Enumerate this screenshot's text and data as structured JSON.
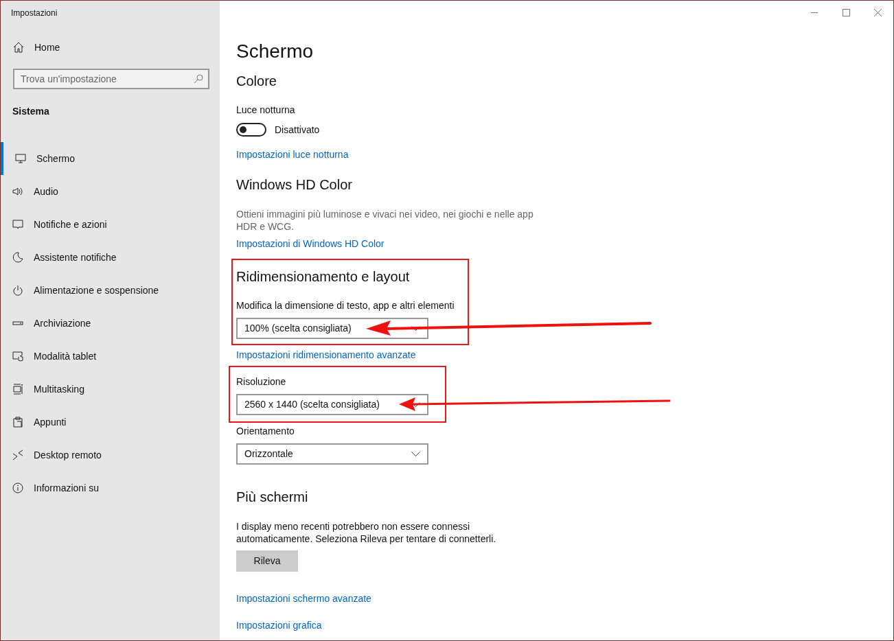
{
  "window": {
    "title": "Impostazioni"
  },
  "sidebar": {
    "home": "Home",
    "search": {
      "placeholder": "Trova un'impostazione"
    },
    "section": "Sistema",
    "items": [
      {
        "label": "Schermo",
        "selected": true
      },
      {
        "label": "Audio",
        "selected": false
      },
      {
        "label": "Notifiche e azioni",
        "selected": false
      },
      {
        "label": "Assistente notifiche",
        "selected": false
      },
      {
        "label": "Alimentazione e sospensione",
        "selected": false
      },
      {
        "label": "Archiviazione",
        "selected": false
      },
      {
        "label": "Modalità tablet",
        "selected": false
      },
      {
        "label": "Multitasking",
        "selected": false
      },
      {
        "label": "Appunti",
        "selected": false
      },
      {
        "label": "Desktop remoto",
        "selected": false
      },
      {
        "label": "Informazioni su",
        "selected": false
      }
    ]
  },
  "content": [
    {
      "kind": "page_title",
      "text": "Schermo"
    },
    {
      "kind": "heading",
      "text": "Colore"
    },
    {
      "kind": "label",
      "text": "Luce notturna"
    },
    {
      "kind": "toggle",
      "on": false,
      "text": "Disattivato"
    },
    {
      "kind": "link",
      "text": "Impostazioni luce notturna"
    },
    {
      "kind": "heading",
      "text": "Windows HD Color"
    },
    {
      "kind": "paragraph",
      "text": "Ottieni immagini più luminose e vivaci nei video, nei giochi e nelle app HDR e WCG.",
      "muted": true
    },
    {
      "kind": "link",
      "text": "Impostazioni di Windows HD Color"
    },
    {
      "kind": "heading",
      "text": "Ridimensionamento e layout"
    },
    {
      "kind": "label",
      "text": "Modifica la dimensione di testo, app e altri elementi"
    },
    {
      "kind": "dropdown",
      "value": "100% (scelta consigliata)"
    },
    {
      "kind": "link",
      "text": "Impostazioni ridimensionamento avanzate"
    },
    {
      "kind": "label",
      "text": "Risoluzione"
    },
    {
      "kind": "dropdown",
      "value": "2560 x 1440 (scelta consigliata)"
    },
    {
      "kind": "label",
      "text": "Orientamento"
    },
    {
      "kind": "dropdown",
      "value": "Orizzontale"
    },
    {
      "kind": "heading",
      "text": "Più schermi"
    },
    {
      "kind": "paragraph",
      "text": "I display meno recenti potrebbero non essere connessi automaticamente. Seleziona Rileva per tentare di connetterli.",
      "muted": false
    },
    {
      "kind": "button",
      "text": "Rileva"
    },
    {
      "kind": "link",
      "text": "Impostazioni schermo avanzate"
    },
    {
      "kind": "link",
      "text": "Impostazioni grafica"
    }
  ]
}
